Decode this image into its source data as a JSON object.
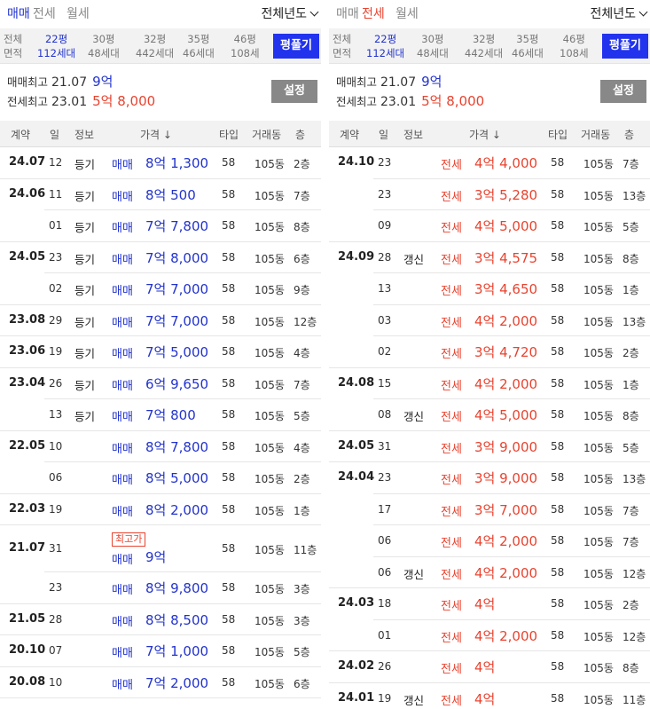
{
  "left": {
    "tabs": [
      "매매",
      "전세",
      "월세"
    ],
    "active_tab": 0,
    "year_select": "전체년도",
    "size_filter": {
      "label": [
        "전체",
        "면적"
      ],
      "options": [
        {
          "size": "22평",
          "units": "112세대"
        },
        {
          "size": "30평",
          "units": "48세대"
        },
        {
          "size": "32평",
          "units": "442세대"
        },
        {
          "size": "35평",
          "units": "46세대"
        },
        {
          "size": "46평",
          "units": "108세"
        }
      ],
      "selected": 0,
      "button": "평풀기"
    },
    "stats": [
      {
        "label": "매매최고",
        "date": "21.07",
        "value": "9억",
        "color": "blue"
      },
      {
        "label": "전세최고",
        "date": "23.01",
        "value": "5억 8,000",
        "color": "red"
      }
    ],
    "settings_button": "설정",
    "headers": [
      "계약",
      "일",
      "정보",
      "가격 ↓",
      "타입",
      "거래동",
      "층"
    ],
    "rows": [
      {
        "month": "24.07",
        "day": "12",
        "info": "등기",
        "type": "매매",
        "value": "8억 1,300",
        "tip": "58",
        "dong": "105동",
        "floor": "2층"
      },
      {
        "month": "24.06",
        "day": "11",
        "info": "등기",
        "type": "매매",
        "value": "8억 500",
        "tip": "58",
        "dong": "105동",
        "floor": "7층"
      },
      {
        "month": "",
        "day": "01",
        "info": "등기",
        "type": "매매",
        "value": "7억 7,800",
        "tip": "58",
        "dong": "105동",
        "floor": "8층"
      },
      {
        "month": "24.05",
        "day": "23",
        "info": "등기",
        "type": "매매",
        "value": "7억 8,000",
        "tip": "58",
        "dong": "105동",
        "floor": "6층"
      },
      {
        "month": "",
        "day": "02",
        "info": "등기",
        "type": "매매",
        "value": "7억 7,000",
        "tip": "58",
        "dong": "105동",
        "floor": "9층"
      },
      {
        "month": "23.08",
        "day": "29",
        "info": "등기",
        "type": "매매",
        "value": "7억 7,000",
        "tip": "58",
        "dong": "105동",
        "floor": "12층"
      },
      {
        "month": "23.06",
        "day": "19",
        "info": "등기",
        "type": "매매",
        "value": "7억 5,000",
        "tip": "58",
        "dong": "105동",
        "floor": "4층"
      },
      {
        "month": "23.04",
        "day": "26",
        "info": "등기",
        "type": "매매",
        "value": "6억 9,650",
        "tip": "58",
        "dong": "105동",
        "floor": "7층"
      },
      {
        "month": "",
        "day": "13",
        "info": "등기",
        "type": "매매",
        "value": "7억 800",
        "tip": "58",
        "dong": "105동",
        "floor": "5층"
      },
      {
        "month": "22.05",
        "day": "10",
        "info": "",
        "type": "매매",
        "value": "8억 7,800",
        "tip": "58",
        "dong": "105동",
        "floor": "4층"
      },
      {
        "month": "",
        "day": "06",
        "info": "",
        "type": "매매",
        "value": "8억 5,000",
        "tip": "58",
        "dong": "105동",
        "floor": "2층"
      },
      {
        "month": "22.03",
        "day": "19",
        "info": "",
        "type": "매매",
        "value": "8억 2,000",
        "tip": "58",
        "dong": "105동",
        "floor": "1층"
      },
      {
        "month": "21.07",
        "day": "31",
        "info": "",
        "badge": "최고가",
        "type": "매매",
        "value": "9억",
        "tip": "58",
        "dong": "105동",
        "floor": "11층"
      },
      {
        "month": "",
        "day": "23",
        "info": "",
        "type": "매매",
        "value": "8억 9,800",
        "tip": "58",
        "dong": "105동",
        "floor": "3층"
      },
      {
        "month": "21.05",
        "day": "28",
        "info": "",
        "type": "매매",
        "value": "8억 8,500",
        "tip": "58",
        "dong": "105동",
        "floor": "3층"
      },
      {
        "month": "20.10",
        "day": "07",
        "info": "",
        "type": "매매",
        "value": "7억 1,000",
        "tip": "58",
        "dong": "105동",
        "floor": "5층"
      },
      {
        "month": "20.08",
        "day": "10",
        "info": "",
        "type": "매매",
        "value": "7억 2,000",
        "tip": "58",
        "dong": "105동",
        "floor": "6층"
      }
    ]
  },
  "right": {
    "tabs": [
      "매매",
      "전세",
      "월세"
    ],
    "active_tab": 1,
    "year_select": "전체년도",
    "size_filter": {
      "label": [
        "전체",
        "면적"
      ],
      "options": [
        {
          "size": "22평",
          "units": "112세대"
        },
        {
          "size": "30평",
          "units": "48세대"
        },
        {
          "size": "32평",
          "units": "442세대"
        },
        {
          "size": "35평",
          "units": "46세대"
        },
        {
          "size": "46평",
          "units": "108세"
        }
      ],
      "selected": 0,
      "button": "평풀기"
    },
    "stats": [
      {
        "label": "매매최고",
        "date": "21.07",
        "value": "9억",
        "color": "blue"
      },
      {
        "label": "전세최고",
        "date": "23.01",
        "value": "5억 8,000",
        "color": "red"
      }
    ],
    "settings_button": "설정",
    "headers": [
      "계약",
      "일",
      "정보",
      "가격 ↓",
      "타입",
      "거래동",
      "층"
    ],
    "rows": [
      {
        "month": "24.10",
        "day": "23",
        "info": "",
        "type": "전세",
        "value": "4억 4,000",
        "tip": "58",
        "dong": "105동",
        "floor": "7층"
      },
      {
        "month": "",
        "day": "23",
        "info": "",
        "type": "전세",
        "value": "3억 5,280",
        "tip": "58",
        "dong": "105동",
        "floor": "13층"
      },
      {
        "month": "",
        "day": "09",
        "info": "",
        "type": "전세",
        "value": "4억 5,000",
        "tip": "58",
        "dong": "105동",
        "floor": "5층"
      },
      {
        "month": "24.09",
        "day": "28",
        "info": "갱신",
        "type": "전세",
        "value": "3억 4,575",
        "tip": "58",
        "dong": "105동",
        "floor": "8층"
      },
      {
        "month": "",
        "day": "13",
        "info": "",
        "type": "전세",
        "value": "3억 4,650",
        "tip": "58",
        "dong": "105동",
        "floor": "1층"
      },
      {
        "month": "",
        "day": "03",
        "info": "",
        "type": "전세",
        "value": "4억 2,000",
        "tip": "58",
        "dong": "105동",
        "floor": "13층"
      },
      {
        "month": "",
        "day": "02",
        "info": "",
        "type": "전세",
        "value": "3억 4,720",
        "tip": "58",
        "dong": "105동",
        "floor": "2층"
      },
      {
        "month": "24.08",
        "day": "15",
        "info": "",
        "type": "전세",
        "value": "4억 2,000",
        "tip": "58",
        "dong": "105동",
        "floor": "1층"
      },
      {
        "month": "",
        "day": "08",
        "info": "갱신",
        "type": "전세",
        "value": "4억 5,000",
        "tip": "58",
        "dong": "105동",
        "floor": "8층"
      },
      {
        "month": "24.05",
        "day": "31",
        "info": "",
        "type": "전세",
        "value": "3억 9,000",
        "tip": "58",
        "dong": "105동",
        "floor": "5층"
      },
      {
        "month": "24.04",
        "day": "23",
        "info": "",
        "type": "전세",
        "value": "3억 9,000",
        "tip": "58",
        "dong": "105동",
        "floor": "13층"
      },
      {
        "month": "",
        "day": "17",
        "info": "",
        "type": "전세",
        "value": "3억 7,000",
        "tip": "58",
        "dong": "105동",
        "floor": "7층"
      },
      {
        "month": "",
        "day": "06",
        "info": "",
        "type": "전세",
        "value": "4억 2,000",
        "tip": "58",
        "dong": "105동",
        "floor": "7층"
      },
      {
        "month": "",
        "day": "06",
        "info": "갱신",
        "type": "전세",
        "value": "4억 2,000",
        "tip": "58",
        "dong": "105동",
        "floor": "12층"
      },
      {
        "month": "24.03",
        "day": "18",
        "info": "",
        "type": "전세",
        "value": "4억",
        "tip": "58",
        "dong": "105동",
        "floor": "2층"
      },
      {
        "month": "",
        "day": "01",
        "info": "",
        "type": "전세",
        "value": "4억 2,000",
        "tip": "58",
        "dong": "105동",
        "floor": "12층"
      },
      {
        "month": "24.02",
        "day": "26",
        "info": "",
        "type": "전세",
        "value": "4억",
        "tip": "58",
        "dong": "105동",
        "floor": "8층"
      },
      {
        "month": "24.01",
        "day": "19",
        "info": "갱신",
        "type": "전세",
        "value": "4억",
        "tip": "58",
        "dong": "105동",
        "floor": "11층"
      }
    ]
  }
}
